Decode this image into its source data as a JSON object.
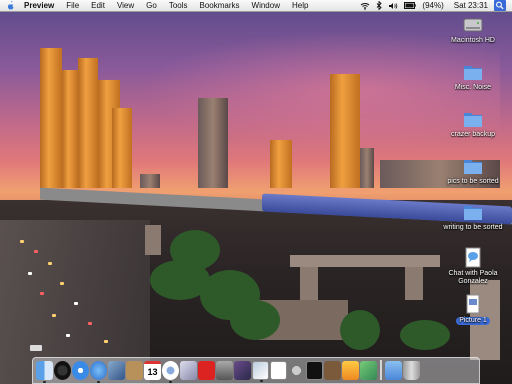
{
  "menubar": {
    "apple": "apple-icon",
    "app_name": "Preview",
    "menus": [
      "File",
      "Edit",
      "View",
      "Go",
      "Tools",
      "Bookmarks",
      "Window",
      "Help"
    ],
    "battery": "(94%)",
    "clock": "Sat 23:31"
  },
  "desktop": {
    "icons": [
      {
        "label": "Macintosh HD",
        "icon": "hard-drive-icon"
      },
      {
        "label": "Misc. Noise",
        "icon": "folder-icon"
      },
      {
        "label": "crazer backup",
        "icon": "folder-icon"
      },
      {
        "label": "pics to be sorted",
        "icon": "folder-icon"
      },
      {
        "label": "writing to be sorted",
        "icon": "folder-icon"
      },
      {
        "label": "Chat with Paola\nGonzalez",
        "icon": "chat-transcript-icon"
      },
      {
        "label": "Picture 1",
        "icon": "document-icon"
      }
    ]
  },
  "dock": {
    "calendar_day": "13",
    "items": [
      "finder",
      "dashboard",
      "safari",
      "ichat",
      "mail",
      "address-book",
      "ical",
      "itunes",
      "iphoto",
      "acrobat",
      "keynote",
      "photoshop",
      "preview",
      "textedit",
      "system-preferences",
      "terminal",
      "dictionary",
      "ftp-client",
      "widgets",
      "applications-folder",
      "trash"
    ]
  },
  "colors": {
    "menubar": "#ececec",
    "folder_blue": "#6aa0e0",
    "dock": "#e6e6eb"
  }
}
